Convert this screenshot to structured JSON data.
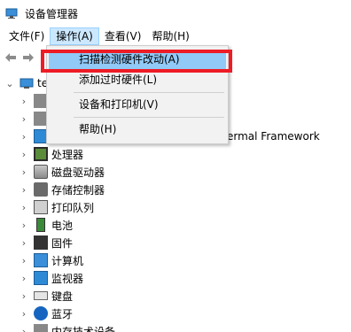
{
  "window": {
    "title": "设备管理器"
  },
  "menu": {
    "items": [
      {
        "label": "文件(F)",
        "active": false
      },
      {
        "label": "操作(A)",
        "active": true
      },
      {
        "label": "查看(V)",
        "active": false
      },
      {
        "label": "帮助(H)",
        "active": false
      }
    ]
  },
  "toolbar": {
    "back_icon": "back-arrow-icon",
    "forward_icon": "forward-arrow-icon"
  },
  "dropdown": {
    "items": [
      {
        "label": "扫描检测硬件改动(A)"
      },
      {
        "label": "添加过时硬件(L)"
      },
      {
        "label": "设备和打印机(V)"
      },
      {
        "label": "帮助(H)"
      }
    ]
  },
  "tree": {
    "root_label": "te",
    "partial_row_label": "ermal Framework",
    "categories": [
      {
        "label": "处理器",
        "icon": "processor-icon"
      },
      {
        "label": "磁盘驱动器",
        "icon": "disk-drive-icon"
      },
      {
        "label": "存储控制器",
        "icon": "storage-controller-icon"
      },
      {
        "label": "打印队列",
        "icon": "print-queue-icon"
      },
      {
        "label": "电池",
        "icon": "battery-icon"
      },
      {
        "label": "固件",
        "icon": "firmware-icon"
      },
      {
        "label": "计算机",
        "icon": "computer-icon"
      },
      {
        "label": "监视器",
        "icon": "monitor-icon"
      },
      {
        "label": "键盘",
        "icon": "keyboard-icon"
      },
      {
        "label": "蓝牙",
        "icon": "bluetooth-icon"
      },
      {
        "label": "内存技术设备",
        "icon": "memory-device-icon"
      }
    ]
  }
}
